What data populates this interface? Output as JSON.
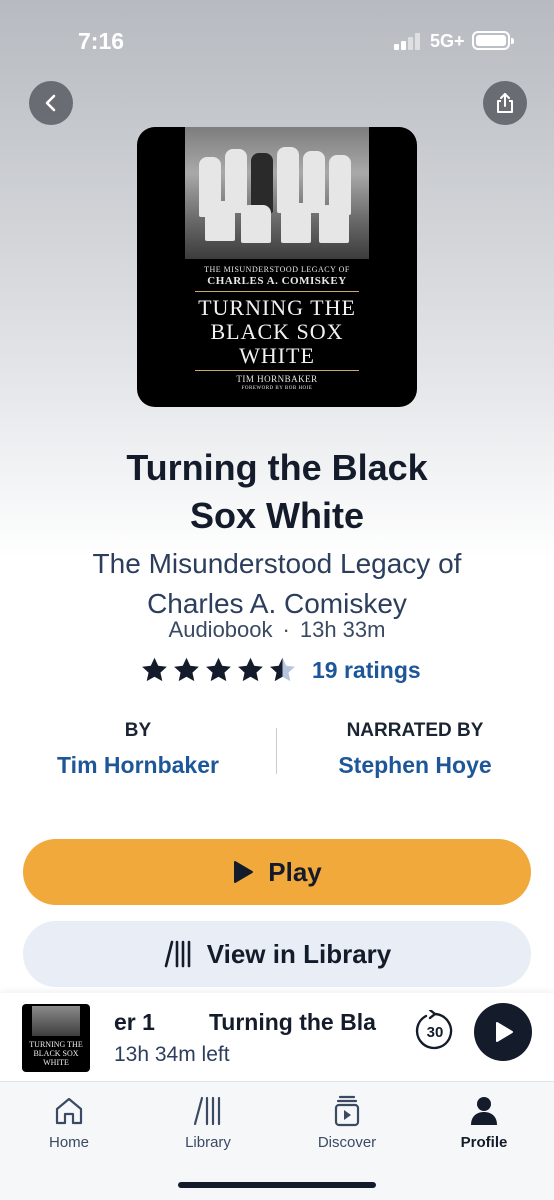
{
  "status_bar": {
    "time": "7:16",
    "network": "5G+"
  },
  "cover": {
    "subtitle_line1": "THE MISUNDERSTOOD LEGACY OF",
    "subtitle_line2": "CHARLES A. COMISKEY",
    "title_line1": "TURNING THE",
    "title_line2": "BLACK SOX",
    "title_line3": "WHITE",
    "author": "TIM HORNBAKER",
    "foreword": "FOREWORD BY BOB HOIE"
  },
  "book": {
    "title": "Turning the Black Sox White",
    "subtitle": "The Misunderstood Legacy of Charles A. Comiskey",
    "format": "Audiobook",
    "duration": "13h 33m",
    "rating": 4.5,
    "ratings_text": "19 ratings"
  },
  "credits": {
    "by_label": "BY",
    "author": "Tim Hornbaker",
    "narrated_label": "NARRATED BY",
    "narrator": "Stephen Hoye"
  },
  "actions": {
    "play_label": "Play",
    "library_label": "View in Library"
  },
  "mini_player": {
    "marquee_part1": "er 1",
    "marquee_part2": "Turning the Bla",
    "time_left": "13h 34m left",
    "skip_seconds": "30",
    "thumb_line1": "TURNING THE",
    "thumb_line2": "BLACK SOX",
    "thumb_line3": "WHITE"
  },
  "tabs": [
    {
      "label": "Home",
      "icon": "home-icon"
    },
    {
      "label": "Library",
      "icon": "library-icon"
    },
    {
      "label": "Discover",
      "icon": "discover-icon"
    },
    {
      "label": "Profile",
      "icon": "profile-icon",
      "active": true
    }
  ],
  "colors": {
    "accent": "#f2a93b",
    "link": "#1e5799",
    "dark": "#141c2b"
  }
}
